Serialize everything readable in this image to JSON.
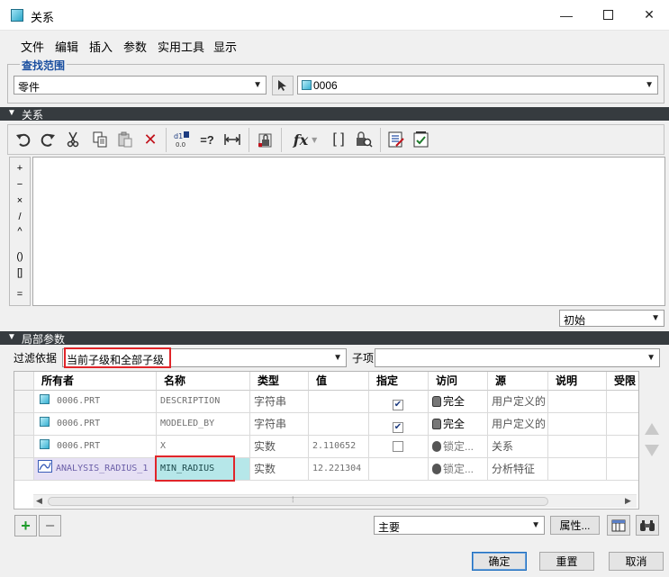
{
  "window": {
    "title": "关系",
    "controls": {
      "minimize": "—",
      "close": "✕"
    }
  },
  "menu": [
    "文件",
    "编辑",
    "插入",
    "参数",
    "实用工具",
    "显示"
  ],
  "search_scope": {
    "legend": "查找范围",
    "scope_value": "零件",
    "model_value": "0006"
  },
  "relations": {
    "header": "关系",
    "operators": [
      "+",
      "−",
      "×",
      "/",
      "^",
      "()",
      "[]",
      "="
    ],
    "editor_text": "",
    "state_value": "初始"
  },
  "local_params": {
    "header": "局部参数",
    "filter_label": "过滤依据",
    "filter_value": "当前子级和全部子级",
    "child_label": "子项",
    "child_value": "",
    "columns": [
      "所有者",
      "名称",
      "类型",
      "值",
      "指定",
      "访问",
      "源",
      "说明",
      "受限"
    ],
    "rows": [
      {
        "owner": "0006.PRT",
        "name": "DESCRIPTION",
        "type": "字符串",
        "value": "",
        "designated": true,
        "access": "完全",
        "source": "用户定义的",
        "owner_icon": "part-icon"
      },
      {
        "owner": "0006.PRT",
        "name": "MODELED_BY",
        "type": "字符串",
        "value": "",
        "designated": true,
        "access": "完全",
        "source": "用户定义的",
        "owner_icon": "part-icon"
      },
      {
        "owner": "0006.PRT",
        "name": "X",
        "type": "实数",
        "value": "2.110652",
        "designated": false,
        "access": "锁定...",
        "source": "关系",
        "owner_icon": "part-icon"
      },
      {
        "owner": "ANALYSIS_RADIUS_1",
        "name": "MIN_RADIUS",
        "type": "实数",
        "value": "12.221304",
        "designated": null,
        "access": "锁定...",
        "source": "分析特征",
        "owner_icon": "analysis-icon"
      }
    ],
    "scroll_grip": "⁞"
  },
  "bottom": {
    "main_combo": "主要",
    "props_label": "属性...",
    "ok_label": "确定",
    "reset_label": "重置",
    "cancel_label": "取消"
  }
}
